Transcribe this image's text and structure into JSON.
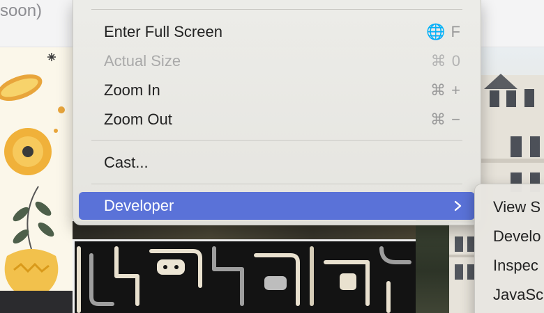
{
  "background": {
    "search_hint": "soon)"
  },
  "menu": {
    "items": [
      {
        "label": "Enter Full Screen",
        "shortcut": "🌐 F",
        "icon": "globe-icon",
        "enabled": true
      },
      {
        "label": "Actual Size",
        "shortcut": "⌘ 0",
        "enabled": false
      },
      {
        "label": "Zoom In",
        "shortcut": "⌘ +",
        "enabled": true
      },
      {
        "label": "Zoom Out",
        "shortcut": "⌘ −",
        "enabled": true
      },
      {
        "label": "Cast...",
        "shortcut": "",
        "enabled": true
      },
      {
        "label": "Developer",
        "shortcut": "",
        "submenu": true,
        "highlighted": true
      }
    ]
  },
  "submenu": {
    "items": [
      "View S",
      "Develo",
      "Inspec",
      "JavaSc"
    ]
  },
  "colors": {
    "highlight": "#5a72d8",
    "menu_background": "#e9e8e4",
    "disabled_text": "#a9a9a9"
  }
}
